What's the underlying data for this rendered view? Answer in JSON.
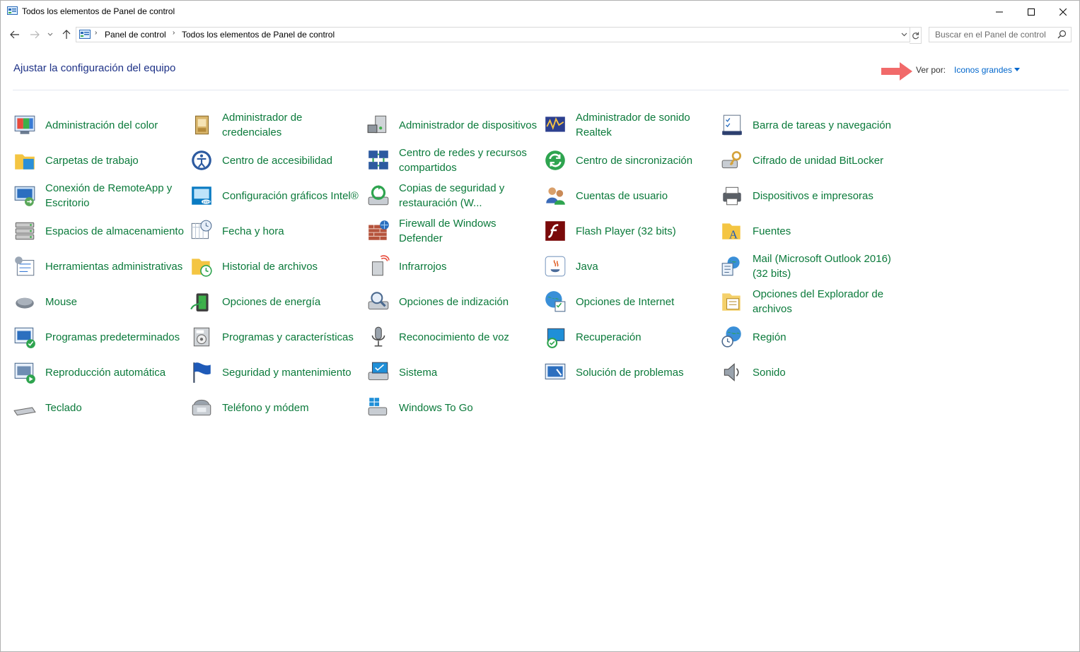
{
  "window": {
    "title": "Todos los elementos de Panel de control",
    "icon": "control-panel-icon",
    "controls": [
      "minimize-icon",
      "maximize-icon",
      "close-icon"
    ]
  },
  "nav": {
    "buttons": [
      "back-arrow-icon",
      "forward-arrow-icon",
      "recent-dropdown-icon",
      "up-arrow-icon"
    ],
    "breadcrumb": [
      "Panel de control",
      "Todos los elementos de Panel de control"
    ],
    "search_placeholder": "Buscar en el Panel de control"
  },
  "header": {
    "title": "Ajustar la configuración del equipo",
    "view_by_label": "Ver por:",
    "view_by_value": "Iconos grandes"
  },
  "colors": {
    "item_text": "#0b7a3b",
    "title_text": "#1e3287",
    "link": "#0066cc",
    "annotation_arrow": "#f05a5a"
  },
  "columns": [
    [
      {
        "label": "Administración del color",
        "icon": "color-management-icon"
      },
      {
        "label": "Carpetas de trabajo",
        "icon": "work-folders-icon"
      },
      {
        "label": "Conexión de RemoteApp y Escritorio",
        "icon": "remoteapp-icon"
      },
      {
        "label": "Espacios de almacenamiento",
        "icon": "storage-spaces-icon"
      },
      {
        "label": "Herramientas administrativas",
        "icon": "admin-tools-icon"
      },
      {
        "label": "Mouse",
        "icon": "mouse-icon"
      },
      {
        "label": "Programas predeterminados",
        "icon": "default-programs-icon"
      },
      {
        "label": "Reproducción automática",
        "icon": "autoplay-icon"
      },
      {
        "label": "Teclado",
        "icon": "keyboard-icon"
      }
    ],
    [
      {
        "label": "Administrador de credenciales",
        "icon": "credential-manager-icon"
      },
      {
        "label": "Centro de accesibilidad",
        "icon": "accessibility-icon"
      },
      {
        "label": "Configuración gráficos Intel®",
        "icon": "intel-graphics-icon"
      },
      {
        "label": "Fecha y hora",
        "icon": "date-time-icon"
      },
      {
        "label": "Historial de archivos",
        "icon": "file-history-icon"
      },
      {
        "label": "Opciones de energía",
        "icon": "power-options-icon"
      },
      {
        "label": "Programas y características",
        "icon": "programs-features-icon"
      },
      {
        "label": "Seguridad y mantenimiento",
        "icon": "security-flag-icon"
      },
      {
        "label": "Teléfono y módem",
        "icon": "phone-modem-icon"
      }
    ],
    [
      {
        "label": "Administrador de dispositivos",
        "icon": "device-manager-icon"
      },
      {
        "label": "Centro de redes y recursos compartidos",
        "icon": "network-center-icon"
      },
      {
        "label": "Copias de seguridad y restauración (W...",
        "icon": "backup-restore-icon"
      },
      {
        "label": "Firewall de Windows Defender",
        "icon": "firewall-icon"
      },
      {
        "label": "Infrarrojos",
        "icon": "infrared-icon"
      },
      {
        "label": "Opciones de indización",
        "icon": "indexing-icon"
      },
      {
        "label": "Reconocimiento de voz",
        "icon": "microphone-icon"
      },
      {
        "label": "Sistema",
        "icon": "system-icon"
      },
      {
        "label": "Windows To Go",
        "icon": "windows-to-go-icon"
      }
    ],
    [
      {
        "label": "Administrador de sonido Realtek",
        "icon": "realtek-sound-icon"
      },
      {
        "label": "Centro de sincronización",
        "icon": "sync-center-icon"
      },
      {
        "label": "Cuentas de usuario",
        "icon": "user-accounts-icon"
      },
      {
        "label": "Flash Player (32 bits)",
        "icon": "flash-player-icon"
      },
      {
        "label": "Java",
        "icon": "java-icon"
      },
      {
        "label": "Opciones de Internet",
        "icon": "internet-options-icon"
      },
      {
        "label": "Recuperación",
        "icon": "recovery-icon"
      },
      {
        "label": "Solución de problemas",
        "icon": "troubleshooting-icon"
      }
    ],
    [
      {
        "label": "Barra de tareas y navegación",
        "icon": "taskbar-icon"
      },
      {
        "label": "Cifrado de unidad BitLocker",
        "icon": "bitlocker-icon"
      },
      {
        "label": "Dispositivos e impresoras",
        "icon": "printer-icon"
      },
      {
        "label": "Fuentes",
        "icon": "fonts-icon"
      },
      {
        "label": "Mail (Microsoft Outlook 2016) (32 bits)",
        "icon": "mail-icon"
      },
      {
        "label": "Opciones del Explorador de archivos",
        "icon": "explorer-options-icon"
      },
      {
        "label": "Región",
        "icon": "region-icon"
      },
      {
        "label": "Sonido",
        "icon": "speaker-icon"
      }
    ]
  ]
}
